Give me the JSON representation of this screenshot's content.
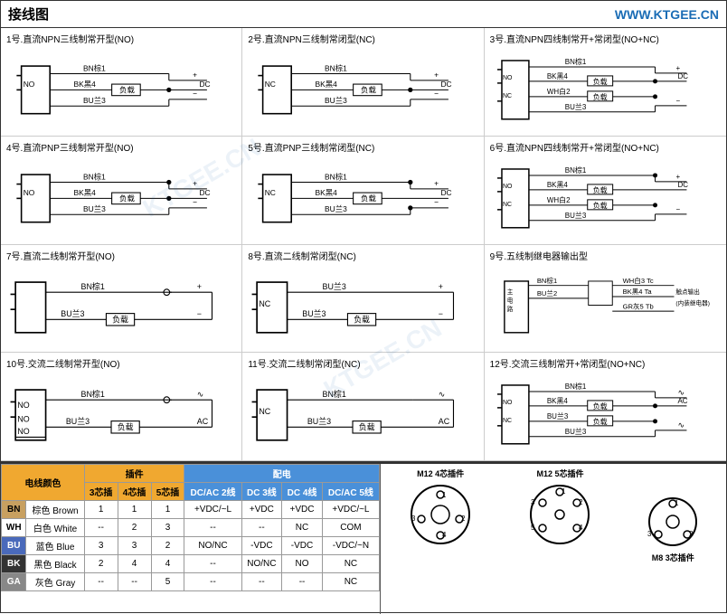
{
  "header": {
    "title": "接线图",
    "url": "WWW.KTGEE.CN"
  },
  "diagrams": [
    {
      "id": 1,
      "title": "1号.直流NPN三线制常开型(NO)"
    },
    {
      "id": 2,
      "title": "2号.直流NPN三线制常闭型(NC)"
    },
    {
      "id": 3,
      "title": "3号.直流NPN四线制常开+常闭型(NO+NC)"
    },
    {
      "id": 4,
      "title": "4号.直流PNP三线制常开型(NO)"
    },
    {
      "id": 5,
      "title": "5号.直流PNP三线制常闭型(NC)"
    },
    {
      "id": 6,
      "title": "6号.直流NPN四线制常开+常闭型(NO+NC)"
    },
    {
      "id": 7,
      "title": "7号.直流二线制常开型(NO)"
    },
    {
      "id": 8,
      "title": "8号.直流二线制常闭型(NC)"
    },
    {
      "id": 9,
      "title": "9号.五线制继电器输出型"
    },
    {
      "id": 10,
      "title": "10号.交流二线制常开型(NO)"
    },
    {
      "id": 11,
      "title": "11号.交流二线制常闭型(NC)"
    },
    {
      "id": 12,
      "title": "12号.交流三线制常开+常闭型(NO+NC)"
    }
  ],
  "table": {
    "wire_color_header": "电线颜色",
    "plugin_header": "插件",
    "wiring_header": "配电",
    "columns_plugin": [
      "3芯插",
      "4芯插",
      "5芯插"
    ],
    "columns_wiring": [
      "DC/AC 2线",
      "DC 3线",
      "DC 4线",
      "DC/AC 5线"
    ],
    "rows": [
      {
        "color": "BN",
        "cn": "棕色 Brown",
        "c3": "1",
        "c4": "1",
        "c5": "1",
        "w2": "+VDC/~L",
        "w3": "+VDC",
        "w4": "+VDC",
        "w5": "+VDC/~L"
      },
      {
        "color": "WH",
        "cn": "白色 White",
        "c3": "--",
        "c4": "2",
        "c5": "3",
        "w2": "--",
        "w3": "--",
        "w4": "NC",
        "w5": "COM"
      },
      {
        "color": "BU",
        "cn": "蓝色 Blue",
        "c3": "3",
        "c4": "3",
        "c5": "2",
        "w2": "NO/NC",
        "w3": "-VDC",
        "w4": "-VDC",
        "w5": "-VDC/~N"
      },
      {
        "color": "BK",
        "cn": "黑色 Black",
        "c3": "2",
        "c4": "4",
        "c5": "4",
        "w2": "--",
        "w3": "NO/NC",
        "w4": "NO",
        "w5": "NC"
      },
      {
        "color": "GA",
        "cn": "灰色 Gray",
        "c3": "--",
        "c4": "--",
        "c5": "5",
        "w2": "--",
        "w3": "--",
        "w4": "--",
        "w5": "NC"
      }
    ],
    "connector_labels": [
      "M12 4芯插件",
      "M12 5芯插件",
      "M8 3芯插件"
    ]
  }
}
